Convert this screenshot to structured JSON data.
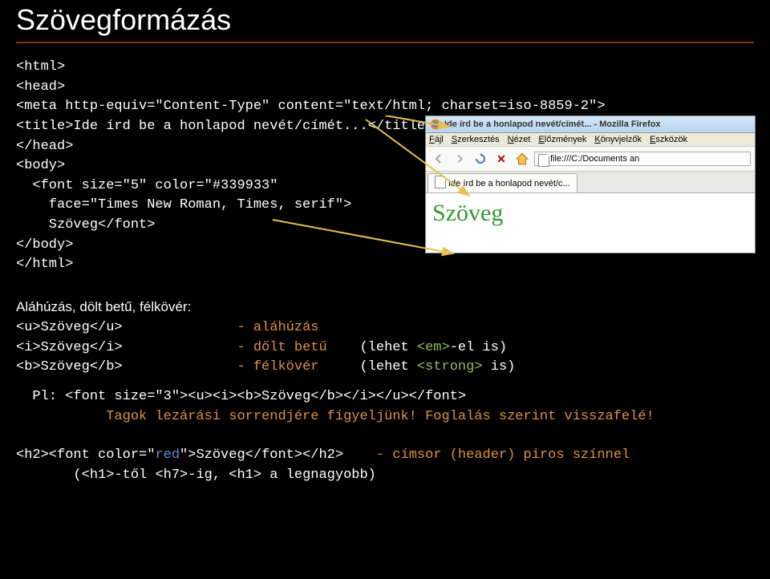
{
  "title": "Szövegformázás",
  "code1": "<html>\n<head>\n<meta http-equiv=\"Content-Type\" content=\"text/html; charset=iso-8859-2\">\n<title>Ide írd be a honlapod nevét/címét...</title>\n</head>\n<body>\n  <font size=\"5\" color=\"#339933\"\n    face=\"Times New Roman, Times, serif\">\n    Szöveg</font>\n</body>\n</html>",
  "subtitle": "Aláhúzás, dölt betű, félkövér:",
  "rows": [
    {
      "tag": "<u>Szöveg</u>",
      "desc": "- aláhúzás",
      "extra": ""
    },
    {
      "tag": "<i>Szöveg</i>",
      "desc": "- dőlt betű",
      "extra_prefix": "(lehet ",
      "extra_kw": "<em>",
      "extra_suffix": "-el is)"
    },
    {
      "tag": "<b>Szöveg</b>",
      "desc": "- félkövér",
      "extra_prefix": "(lehet ",
      "extra_kw": "<strong>",
      "extra_suffix": " is)"
    }
  ],
  "example_label": "Pl: ",
  "example_code": "<font size=\"3\"><u><i><b>Szöveg</b></i></u></font>",
  "example_note": "Tagok lezárási sorrendjére figyeljünk! Foglalás szerint visszafelé!",
  "h2_pre": "<h2><font color=\"",
  "h2_color": "red",
  "h2_mid": "\">Szöveg</font></h2>",
  "h2_desc": "- címsor (header) piros színnel",
  "h2_note": "(<h1>-től <h7>-ig, <h1> a legnagyobb)",
  "window": {
    "title": "Ide írd be a honlapod nevét/címét... - Mozilla Firefox",
    "menu": [
      "Fájl",
      "Szerkesztés",
      "Nézet",
      "Előzmények",
      "Könyvjelzők",
      "Eszközök"
    ],
    "url": "file:///C:/Documents an",
    "tab": "Ide írd be a honlapod nevét/c...",
    "content": "Szöveg"
  }
}
